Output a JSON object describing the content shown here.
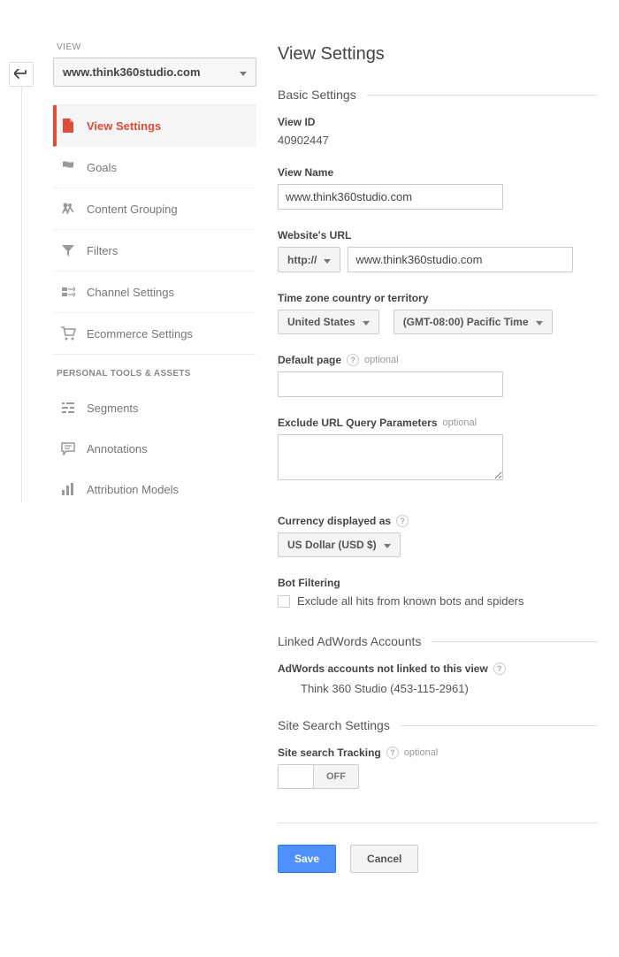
{
  "sidebar": {
    "view_label": "VIEW",
    "view_name": "www.think360studio.com",
    "nav": [
      {
        "label": "View Settings"
      },
      {
        "label": "Goals"
      },
      {
        "label": "Content Grouping"
      },
      {
        "label": "Filters"
      },
      {
        "label": "Channel Settings"
      },
      {
        "label": "Ecommerce Settings"
      }
    ],
    "personal_header": "PERSONAL TOOLS & ASSETS",
    "personal": [
      {
        "label": "Segments"
      },
      {
        "label": "Annotations"
      },
      {
        "label": "Attribution Models"
      }
    ]
  },
  "page": {
    "title": "View Settings",
    "basic_header": "Basic Settings",
    "view_id_label": "View ID",
    "view_id": "40902447",
    "view_name_label": "View Name",
    "view_name": "www.think360studio.com",
    "url_label": "Website's URL",
    "protocol": "http://",
    "url": "www.think360studio.com",
    "tz_label": "Time zone country or territory",
    "tz_country": "United States",
    "tz_value": "(GMT-08:00) Pacific Time",
    "default_page_label": "Default page",
    "optional": "optional",
    "exclude_label": "Exclude URL Query Parameters",
    "currency_label": "Currency displayed as",
    "currency": "US Dollar (USD $)",
    "bot_header": "Bot Filtering",
    "bot_checkbox": "Exclude all hits from known bots and spiders",
    "linked_header": "Linked AdWords Accounts",
    "linked_label": "AdWords accounts not linked to this view",
    "linked_account": "Think 360 Studio (453-115-2961)",
    "search_header": "Site Search Settings",
    "search_label": "Site search Tracking",
    "toggle_state": "OFF",
    "save": "Save",
    "cancel": "Cancel"
  }
}
